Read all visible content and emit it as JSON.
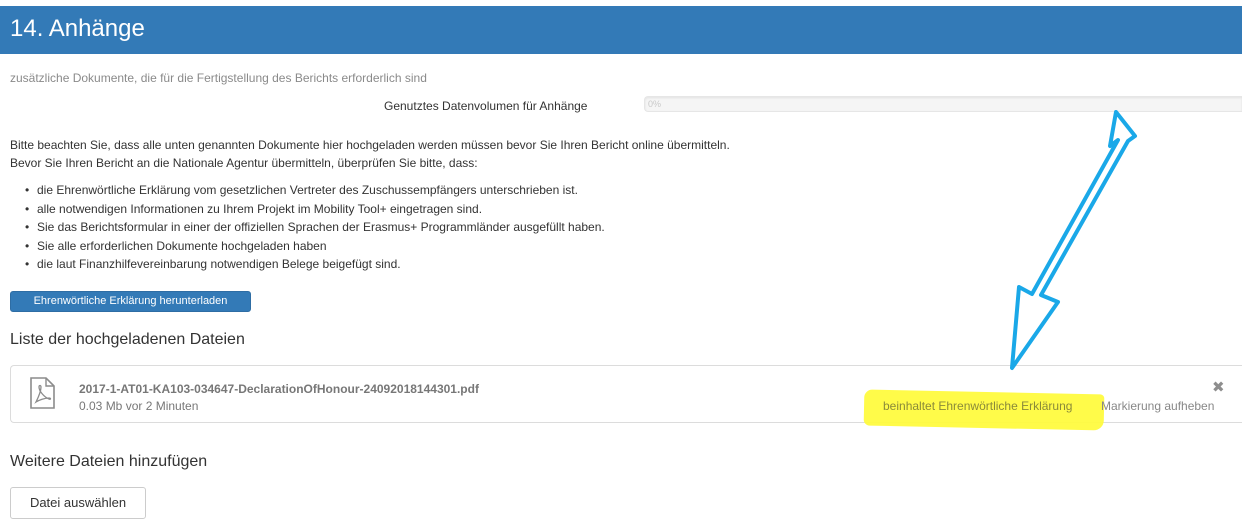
{
  "section": {
    "title": "14. Anhänge"
  },
  "subtitle": "zusätzliche Dokumente, die für die Fertigstellung des Berichts erforderlich sind",
  "volume": {
    "label": "Genutztes Datenvolumen für Anhänge",
    "percent_text": "0%",
    "fill_fraction": 0.0
  },
  "intro": {
    "line1": "Bitte beachten Sie, dass alle unten genannten Dokumente hier hochgeladen werden müssen bevor Sie Ihren Bericht online übermitteln.",
    "line2": "Bevor Sie Ihren Bericht an die Nationale Agentur übermitteln, überprüfen Sie bitte, dass:"
  },
  "checklist": [
    "die Ehrenwörtliche Erklärung vom gesetzlichen Vertreter des Zuschussempfängers unterschrieben ist.",
    "alle notwendigen Informationen zu Ihrem Projekt im Mobility Tool+ eingetragen sind.",
    "Sie das Berichtsformular in einer der offiziellen Sprachen der Erasmus+ Programmländer ausgefüllt haben.",
    "Sie alle erforderlichen Dokumente hochgeladen haben",
    "die laut Finanzhilfevereinbarung notwendigen Belege beigefügt sind."
  ],
  "download_button": {
    "label": "Ehrenwörtliche Erklärung herunterladen"
  },
  "uploaded": {
    "heading": "Liste der hochgeladenen Dateien",
    "files": [
      {
        "name": "2017-1-AT01-KA103-034647-DeclarationOfHonour-24092018144301.pdf",
        "meta": "0.03 Mb vor 2 Minuten",
        "tag": "beinhaltet Ehrenwörtliche Erklärung",
        "unmark": "Markierung aufheben",
        "remove_icon": "close-icon"
      }
    ]
  },
  "add": {
    "heading": "Weitere Dateien hinzufügen",
    "button_label": "Datei auswählen"
  },
  "colors": {
    "primary": "#337ab7",
    "highlight": "#fffb3a",
    "annotation_arrow": "#1aa8e8"
  }
}
